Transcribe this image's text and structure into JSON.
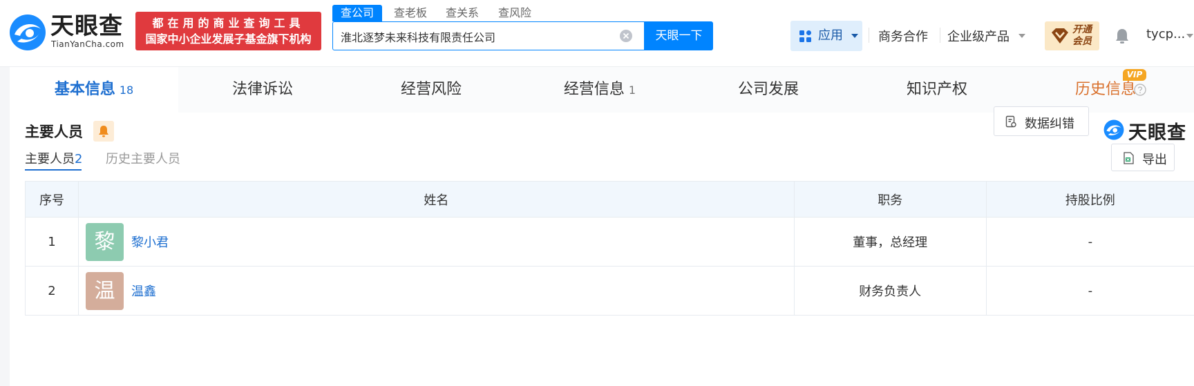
{
  "header": {
    "logo_title": "天眼查",
    "logo_sub": "TianYanCha.com",
    "slogan_line1": "都在用的商业查询工具",
    "slogan_line2": "国家中小企业发展子基金旗下机构",
    "search_tabs": [
      "查公司",
      "查老板",
      "查关系",
      "查风险"
    ],
    "search_value": "淮北逐梦未来科技有限责任公司",
    "search_button": "天眼一下",
    "apps_label": "应用",
    "business_link": "商务合作",
    "enterprise_link": "企业级产品",
    "vip_badge": "开通会员",
    "user_name": "tycp..."
  },
  "tabs": [
    {
      "label": "基本信息",
      "count": "18"
    },
    {
      "label": "法律诉讼",
      "count": ""
    },
    {
      "label": "经营风险",
      "count": ""
    },
    {
      "label": "经营信息",
      "count": "1"
    },
    {
      "label": "公司发展",
      "count": ""
    },
    {
      "label": "知识产权",
      "count": ""
    },
    {
      "label": "历史信息",
      "count": ""
    }
  ],
  "vip_tag": "VIP",
  "section": {
    "title": "主要人员",
    "report_error_button": "数据纠错",
    "brand": "天眼查",
    "export_button": "导出",
    "sub_tabs": [
      {
        "label": "主要人员",
        "count": "2"
      },
      {
        "label": "历史主要人员",
        "count": ""
      }
    ]
  },
  "table": {
    "headers": [
      "序号",
      "姓名",
      "职务",
      "持股比例"
    ],
    "rows": [
      {
        "index": "1",
        "avatar_char": "黎",
        "avatar_color": "#8dcbb0",
        "name": "黎小君",
        "position": "董事，总经理",
        "share": "-"
      },
      {
        "index": "2",
        "avatar_char": "温",
        "avatar_color": "#d4ad9b",
        "name": "温鑫",
        "position": "财务负责人",
        "share": "-"
      }
    ]
  },
  "colors": {
    "accent": "#0084ff",
    "link": "#1e6fd0",
    "slogan_bg": "#e03a3e",
    "history_tab": "#d9702c"
  }
}
